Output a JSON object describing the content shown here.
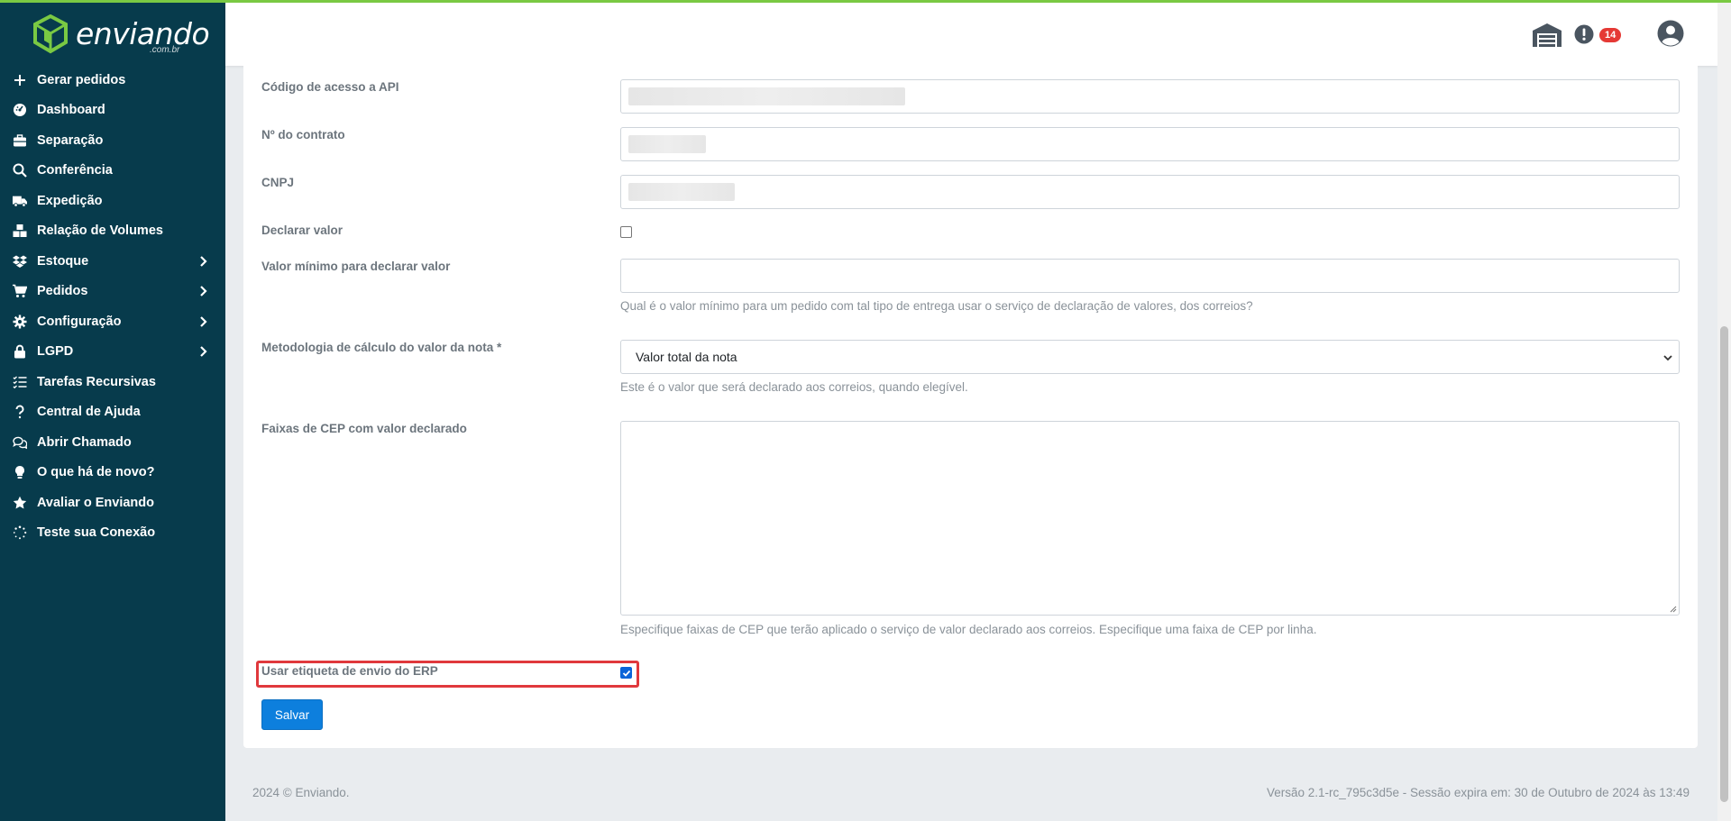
{
  "brand": {
    "name": "enviando",
    "suffix": ".com.br"
  },
  "sidebar": {
    "items": [
      {
        "label": "Gerar pedidos",
        "icon": "plus-icon",
        "submenu": false
      },
      {
        "label": "Dashboard",
        "icon": "dashboard-icon",
        "submenu": false
      },
      {
        "label": "Separação",
        "icon": "briefcase-icon",
        "submenu": false
      },
      {
        "label": "Conferência",
        "icon": "search-icon",
        "submenu": false
      },
      {
        "label": "Expedição",
        "icon": "truck-icon",
        "submenu": false
      },
      {
        "label": "Relação de Volumes",
        "icon": "boxes-icon",
        "submenu": false
      },
      {
        "label": "Estoque",
        "icon": "dropbox-icon",
        "submenu": true
      },
      {
        "label": "Pedidos",
        "icon": "cart-icon",
        "submenu": true
      },
      {
        "label": "Configuração",
        "icon": "gear-icon",
        "submenu": true
      },
      {
        "label": "LGPD",
        "icon": "lock-icon",
        "submenu": true
      },
      {
        "label": "Tarefas Recursivas",
        "icon": "tasks-icon",
        "submenu": false
      },
      {
        "label": "Central de Ajuda",
        "icon": "question-icon",
        "submenu": false
      },
      {
        "label": "Abrir Chamado",
        "icon": "chat-icon",
        "submenu": false
      },
      {
        "label": "O que há de novo?",
        "icon": "lightbulb-icon",
        "submenu": false
      },
      {
        "label": "Avaliar o Enviando",
        "icon": "star-icon",
        "submenu": false
      },
      {
        "label": "Teste sua Conexão",
        "icon": "spinner-icon",
        "submenu": false
      }
    ]
  },
  "header": {
    "notification_count": "14",
    "icons": [
      "warehouse-icon",
      "alert-icon",
      "user-icon"
    ]
  },
  "form": {
    "api_code_label": "Código de acesso a API",
    "contract_label": "Nº do contrato",
    "cnpj_label": "CNPJ",
    "declare_value_label": "Declarar valor",
    "declare_value_checked": false,
    "min_value_label": "Valor mínimo para declarar valor",
    "min_value_value": "",
    "min_value_help": "Qual é o valor mínimo para um pedido com tal tipo de entrega usar o serviço de declaração de valores, dos correios?",
    "method_label": "Metodologia de cálculo do valor da nota *",
    "method_selected": "Valor total da nota",
    "method_help": "Este é o valor que será declarado aos correios, quando elegível.",
    "cep_label": "Faixas de CEP com valor declarado",
    "cep_value": "",
    "cep_help": "Especifique faixas de CEP que terão aplicado o serviço de valor declarado aos correios. Especifique uma faixa de CEP por linha.",
    "erp_label": "Usar etiqueta de envio do ERP",
    "erp_checked": true,
    "save_label": "Salvar"
  },
  "footer": {
    "copyright": "2024 © Enviando.",
    "version": "Versão 2.1-rc_795c3d5e - Sessão expira em: 30 de Outubro de 2024 às 13:49"
  },
  "colors": {
    "sidebar_bg": "#073b4c",
    "accent_green": "#7ac943",
    "primary": "#0d7fdd",
    "badge": "#e53935",
    "highlight": "#e0383c"
  }
}
